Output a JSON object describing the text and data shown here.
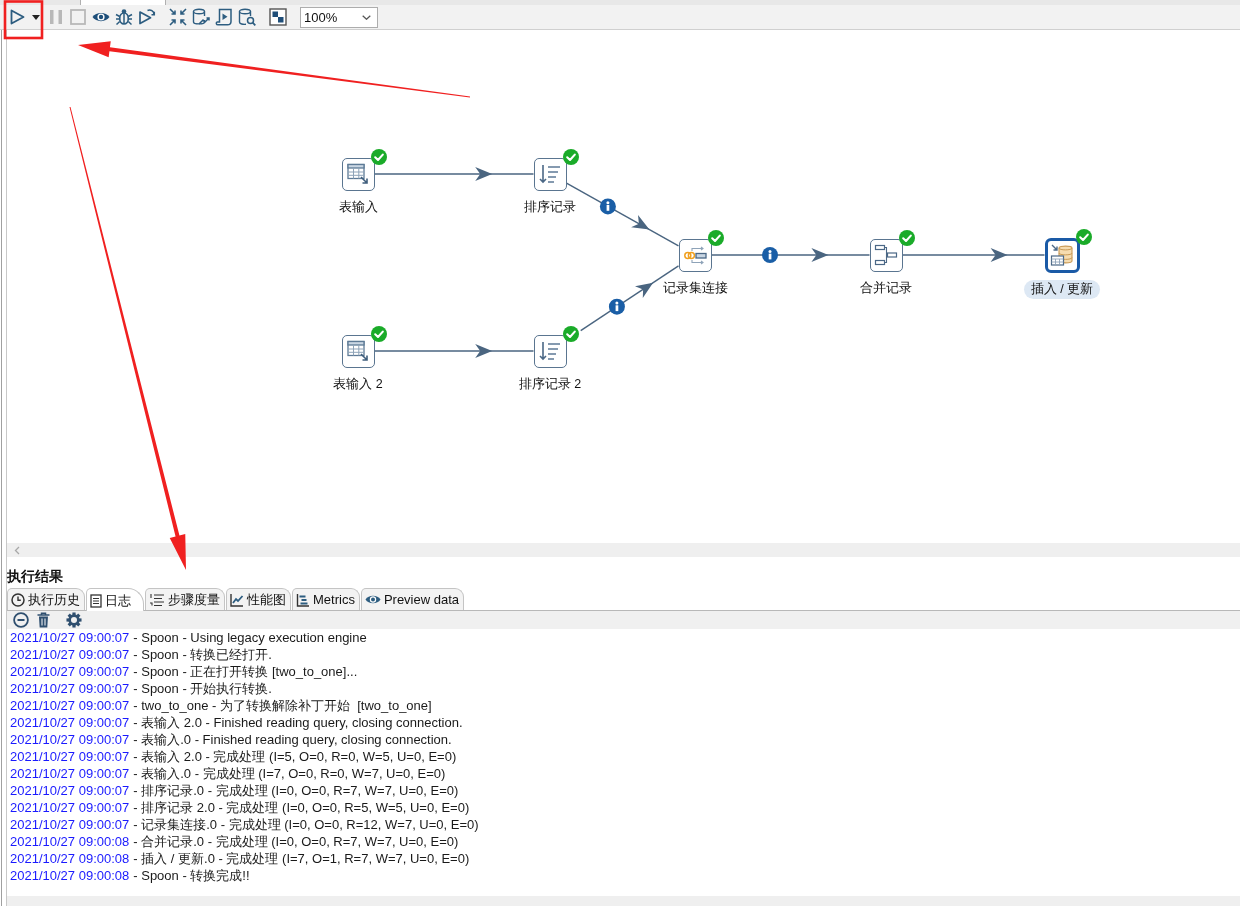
{
  "toolbar": {
    "buttons": [
      {
        "disabled": false
      },
      {
        "disabled": false
      },
      {
        "disabled": true
      },
      {
        "disabled": true
      },
      {
        "disabled": false
      },
      {
        "disabled": false
      },
      {
        "disabled": false
      },
      {
        "disabled": false
      },
      {
        "disabled": false
      },
      {
        "disabled": false
      },
      {
        "disabled": false
      },
      {
        "disabled": false
      }
    ],
    "zoom": "100%"
  },
  "canvas": {
    "steps": [
      {
        "kind": "table_input",
        "label": "表输入",
        "finished": true,
        "selected": false
      },
      {
        "kind": "sort_rows",
        "label": "排序记录",
        "finished": true,
        "selected": false
      },
      {
        "kind": "merge_join",
        "label": "记录集连接",
        "finished": true,
        "selected": false
      },
      {
        "kind": "merge_rows",
        "label": "合并记录",
        "finished": true,
        "selected": false
      },
      {
        "kind": "insert_update",
        "label": "插入 / 更新",
        "finished": true,
        "selected": true
      },
      {
        "kind": "table_input",
        "label": "表输入 2",
        "finished": true,
        "selected": false
      },
      {
        "kind": "sort_rows",
        "label": "排序记录 2",
        "finished": true,
        "selected": false
      }
    ],
    "hops": [
      {
        "info": false
      },
      {
        "info": true
      },
      {
        "info": false
      },
      {
        "info": true
      },
      {
        "info": true
      },
      {
        "info": false
      }
    ]
  },
  "results": {
    "title": "执行结果",
    "tabs": [
      {
        "label": "执行历史",
        "selected": false
      },
      {
        "label": "日志",
        "selected": true
      },
      {
        "label": "步骤度量",
        "selected": false
      },
      {
        "label": "性能图",
        "selected": false
      },
      {
        "label": "Metrics",
        "selected": false
      },
      {
        "label": "Preview data",
        "selected": false
      }
    ],
    "log": [
      {
        "time": "2021/10/27 09:00:07",
        "message": "- Spoon - Using legacy execution engine"
      },
      {
        "time": "2021/10/27 09:00:07",
        "message": "- Spoon - 转换已经打开."
      },
      {
        "time": "2021/10/27 09:00:07",
        "message": "- Spoon - 正在打开转换 [two_to_one]..."
      },
      {
        "time": "2021/10/27 09:00:07",
        "message": "- Spoon - 开始执行转换."
      },
      {
        "time": "2021/10/27 09:00:07",
        "message": "- two_to_one - 为了转换解除补丁开始  [two_to_one]"
      },
      {
        "time": "2021/10/27 09:00:07",
        "message": "- 表输入 2.0 - Finished reading query, closing connection."
      },
      {
        "time": "2021/10/27 09:00:07",
        "message": "- 表输入.0 - Finished reading query, closing connection."
      },
      {
        "time": "2021/10/27 09:00:07",
        "message": "- 表输入 2.0 - 完成处理 (I=5, O=0, R=0, W=5, U=0, E=0)"
      },
      {
        "time": "2021/10/27 09:00:07",
        "message": "- 表输入.0 - 完成处理 (I=7, O=0, R=0, W=7, U=0, E=0)"
      },
      {
        "time": "2021/10/27 09:00:07",
        "message": "- 排序记录.0 - 完成处理 (I=0, O=0, R=7, W=7, U=0, E=0)"
      },
      {
        "time": "2021/10/27 09:00:07",
        "message": "- 排序记录 2.0 - 完成处理 (I=0, O=0, R=5, W=5, U=0, E=0)"
      },
      {
        "time": "2021/10/27 09:00:07",
        "message": "- 记录集连接.0 - 完成处理 (I=0, O=0, R=12, W=7, U=0, E=0)"
      },
      {
        "time": "2021/10/27 09:00:08",
        "message": "- 合并记录.0 - 完成处理 (I=0, O=0, R=7, W=7, U=0, E=0)"
      },
      {
        "time": "2021/10/27 09:00:08",
        "message": "- 插入 / 更新.0 - 完成处理 (I=7, O=1, R=7, W=7, U=0, E=0)"
      },
      {
        "time": "2021/10/27 09:00:08",
        "message": "- Spoon - 转换完成!!"
      }
    ]
  }
}
